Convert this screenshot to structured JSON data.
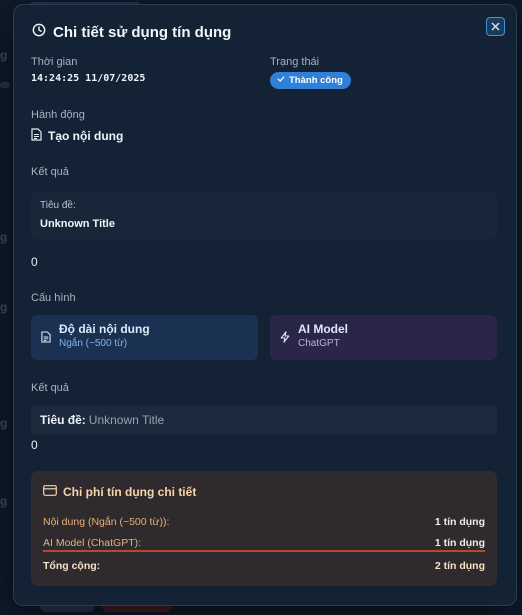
{
  "modal": {
    "title": "Chi tiết sử dụng tín dụng",
    "time_label": "Thời gian",
    "time_value": "14:24:25 11/07/2025",
    "status_label": "Trạng thái",
    "status_value": "Thành công",
    "action_label": "Hành động",
    "action_value": "Tạo nội dung",
    "result_label": "Kết quả",
    "result_title_label": "Tiêu đề:",
    "result_title_value": "Unknown Title",
    "result_number": "0",
    "config_label": "Cấu hình",
    "config_length_title": "Độ dài nội dung",
    "config_length_value": "Ngắn (~500 từ)",
    "config_ai_title": "AI Model",
    "config_ai_value": "ChatGPT",
    "result2_label": "Kết quả",
    "result2_title_label": "Tiêu đề:",
    "result2_title_value": "Unknown Title",
    "result2_number": "0",
    "cost_title": "Chi phí tín dụng chi tiết",
    "cost_rows": [
      {
        "label": "Nội dung (Ngắn (~500 từ)):",
        "value": "1 tín dụng"
      },
      {
        "label": "AI Model (ChatGPT):",
        "value": "1 tín dụng"
      }
    ],
    "cost_total_label": "Tổng cộng:",
    "cost_total_value": "2 tín dụng"
  },
  "colors": {
    "accent": "#2f80d6",
    "success_badge": "#2f80d6",
    "cost_text": "#e6b277",
    "cost_divider": "#b34a2e"
  },
  "icons": [
    "clock-icon",
    "close-icon",
    "check-icon",
    "document-icon",
    "bolt-icon",
    "credit-card-icon"
  ]
}
